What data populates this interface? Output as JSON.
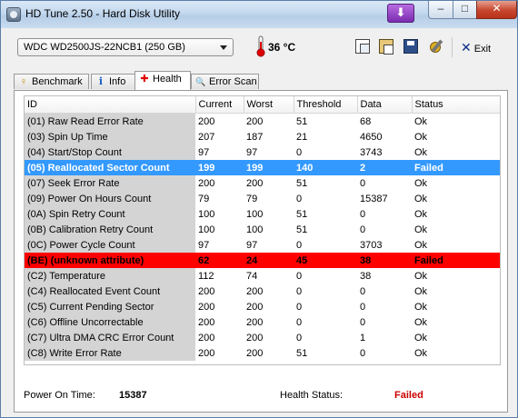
{
  "window": {
    "title": "HD Tune 2.50 - Hard Disk Utility",
    "minimize": "–",
    "maximize": "□",
    "close": "✕",
    "download_glyph": "⬇"
  },
  "toolbar": {
    "drive": "WDC WD2500JS-22NCB1 (250 GB)",
    "temperature": "36 °C",
    "icons": [
      "copy-icon",
      "paste-icon",
      "save-icon",
      "options-icon"
    ],
    "exit_label": "Exit"
  },
  "tabs": [
    {
      "label": "Benchmark",
      "icon": "benchmark-icon",
      "glyph": "♀",
      "active": false
    },
    {
      "label": "Info",
      "icon": "info-icon",
      "glyph": "i",
      "active": false
    },
    {
      "label": "Health",
      "icon": "health-cross-icon",
      "glyph": "✚",
      "active": true
    },
    {
      "label": "Error Scan",
      "icon": "magnifier-icon",
      "glyph": "🔍",
      "active": false
    }
  ],
  "table": {
    "columns": [
      "ID",
      "Current",
      "Worst",
      "Threshold",
      "Data",
      "Status"
    ],
    "rows": [
      [
        "(01) Raw Read Error Rate",
        "200",
        "200",
        "51",
        "68",
        "Ok"
      ],
      [
        "(03) Spin Up Time",
        "207",
        "187",
        "21",
        "4650",
        "Ok"
      ],
      [
        "(04) Start/Stop Count",
        "97",
        "97",
        "0",
        "3743",
        "Ok"
      ],
      [
        "(05) Reallocated Sector Count",
        "199",
        "199",
        "140",
        "2",
        "Failed"
      ],
      [
        "(07) Seek Error Rate",
        "200",
        "200",
        "51",
        "0",
        "Ok"
      ],
      [
        "(09) Power On Hours Count",
        "79",
        "79",
        "0",
        "15387",
        "Ok"
      ],
      [
        "(0A) Spin Retry Count",
        "100",
        "100",
        "51",
        "0",
        "Ok"
      ],
      [
        "(0B) Calibration Retry Count",
        "100",
        "100",
        "51",
        "0",
        "Ok"
      ],
      [
        "(0C) Power Cycle Count",
        "97",
        "97",
        "0",
        "3703",
        "Ok"
      ],
      [
        "(BE) (unknown attribute)",
        "62",
        "24",
        "45",
        "38",
        "Failed"
      ],
      [
        "(C2) Temperature",
        "112",
        "74",
        "0",
        "38",
        "Ok"
      ],
      [
        "(C4) Reallocated Event Count",
        "200",
        "200",
        "0",
        "0",
        "Ok"
      ],
      [
        "(C5) Current Pending Sector",
        "200",
        "200",
        "0",
        "0",
        "Ok"
      ],
      [
        "(C6) Offline Uncorrectable",
        "200",
        "200",
        "0",
        "0",
        "Ok"
      ],
      [
        "(C7) Ultra DMA CRC Error Count",
        "200",
        "200",
        "0",
        "1",
        "Ok"
      ],
      [
        "(C8) Write Error Rate",
        "200",
        "200",
        "51",
        "0",
        "Ok"
      ]
    ],
    "selected_row": 3,
    "failed_highlight_row": 9
  },
  "footer": {
    "power_on_label": "Power On Time:",
    "power_on_value": "15387",
    "health_label": "Health Status:",
    "health_value": "Failed"
  },
  "colors": {
    "selected": "#3399ff",
    "failed_row": "#ff0000",
    "failed_text": "#cc0000"
  }
}
